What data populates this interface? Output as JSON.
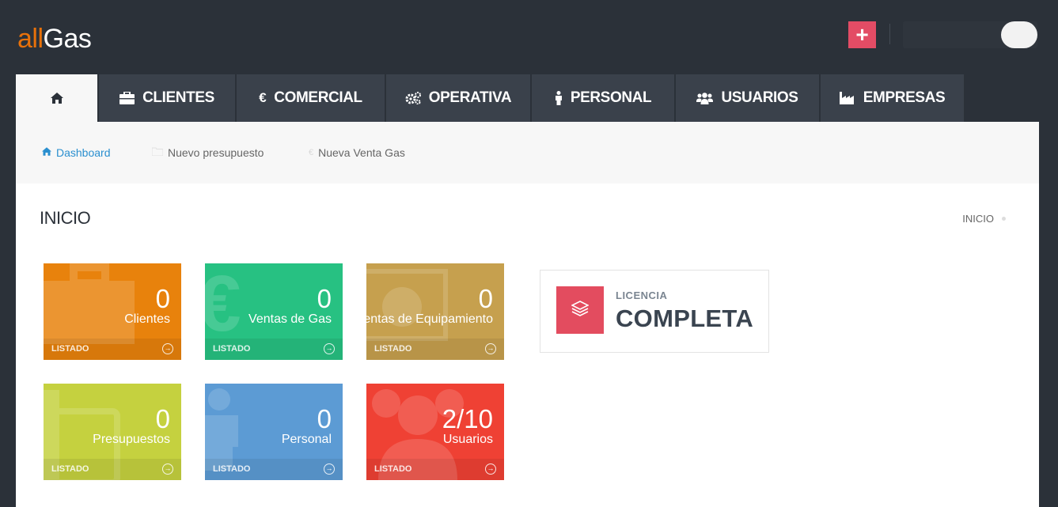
{
  "header": {
    "logo_part1": "all",
    "logo_part2": "Gas",
    "plus_label": "+"
  },
  "nav": {
    "items": [
      {
        "label": "",
        "icon": "home-icon"
      },
      {
        "label": "CLIENTES",
        "icon": "briefcase-icon"
      },
      {
        "label": "COMERCIAL",
        "icon": "euro-icon"
      },
      {
        "label": "OPERATIVA",
        "icon": "cogs-icon"
      },
      {
        "label": "PERSONAL",
        "icon": "person-icon"
      },
      {
        "label": "USUARIOS",
        "icon": "users-icon"
      },
      {
        "label": "EMPRESAS",
        "icon": "industry-icon"
      }
    ]
  },
  "shortcuts": {
    "dashboard": "Dashboard",
    "nuevo_presupuesto": "Nuevo presupuesto",
    "nueva_venta_gas": "Nueva Venta Gas"
  },
  "page": {
    "title": "INICIO",
    "breadcrumb": "INICIO"
  },
  "tiles": [
    {
      "value": "0",
      "label": "Clientes",
      "footer": "LISTADO",
      "color": "#e8820c"
    },
    {
      "value": "0",
      "label": "Ventas de Gas",
      "footer": "LISTADO",
      "color": "#27c182"
    },
    {
      "value": "0",
      "label": "entas de Equipamiento",
      "footer": "LISTADO",
      "color": "#c6a04e"
    },
    {
      "value": "0",
      "label": "Presupuestos",
      "footer": "LISTADO",
      "color": "#c5d13f"
    },
    {
      "value": "0",
      "label": "Personal",
      "footer": "LISTADO",
      "color": "#5c9bd4"
    },
    {
      "value": "2/10",
      "label": "Usuarios",
      "footer": "LISTADO",
      "color": "#ef4134"
    }
  ],
  "license": {
    "subtitle": "LICENCIA",
    "value": "COMPLETA",
    "color": "#e34c5f"
  }
}
